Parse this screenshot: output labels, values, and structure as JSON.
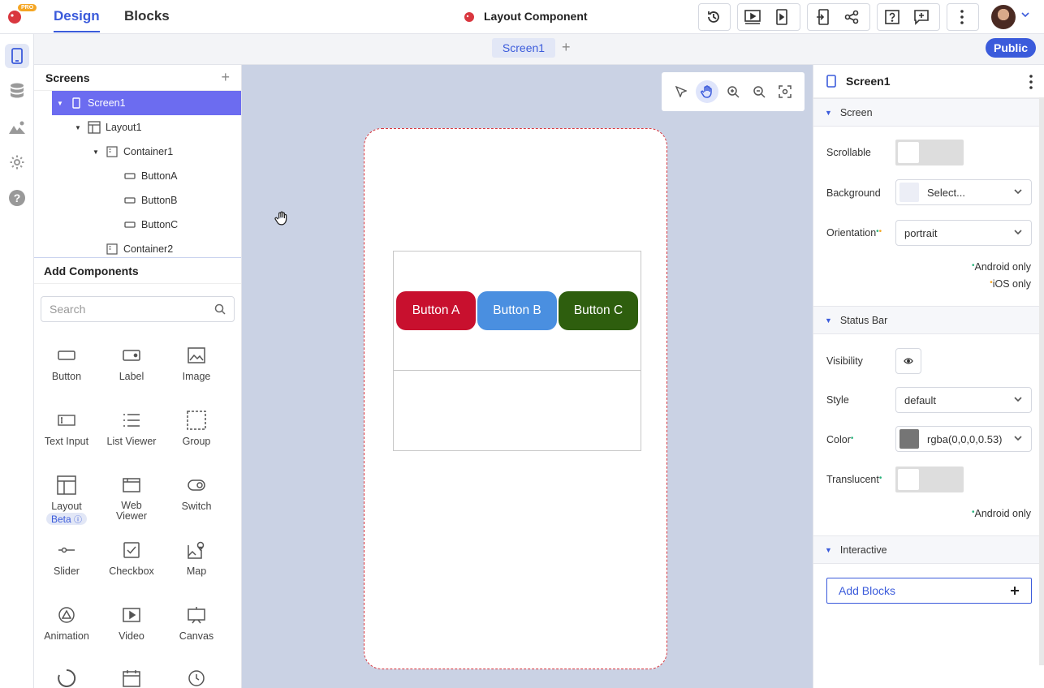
{
  "topbar": {
    "badge": "PRO",
    "tabs": [
      "Design",
      "Blocks"
    ],
    "project_title": "Layout Component"
  },
  "screenbar": {
    "screen_tab": "Screen1",
    "add": "+",
    "public_label": "Public"
  },
  "screens_panel": {
    "title": "Screens",
    "add": "+",
    "tree": [
      {
        "label": "Screen1",
        "icon": "phone-icon"
      },
      {
        "label": "Layout1",
        "icon": "layout-icon"
      },
      {
        "label": "Container1",
        "icon": "container-icon"
      },
      {
        "label": "ButtonA",
        "icon": "button-icon"
      },
      {
        "label": "ButtonB",
        "icon": "button-icon"
      },
      {
        "label": "ButtonC",
        "icon": "button-icon"
      },
      {
        "label": "Container2",
        "icon": "container-icon"
      }
    ]
  },
  "components_panel": {
    "title": "Add Components",
    "search_placeholder": "Search",
    "items": [
      {
        "label": "Button",
        "icon": "button-icon"
      },
      {
        "label": "Label",
        "icon": "label-icon"
      },
      {
        "label": "Image",
        "icon": "image-icon"
      },
      {
        "label": "Text Input",
        "icon": "text-input-icon"
      },
      {
        "label": "List Viewer",
        "icon": "list-icon"
      },
      {
        "label": "Group",
        "icon": "group-icon"
      },
      {
        "label": "Layout",
        "icon": "layout-icon",
        "badge": "Beta"
      },
      {
        "label": "Web Viewer",
        "icon": "web-viewer-icon"
      },
      {
        "label": "Switch",
        "icon": "switch-icon"
      },
      {
        "label": "Slider",
        "icon": "slider-icon"
      },
      {
        "label": "Checkbox",
        "icon": "checkbox-icon"
      },
      {
        "label": "Map",
        "icon": "map-icon"
      },
      {
        "label": "Animation",
        "icon": "animation-icon"
      },
      {
        "label": "Video",
        "icon": "video-icon"
      },
      {
        "label": "Canvas",
        "icon": "canvas-icon"
      }
    ]
  },
  "canvas": {
    "buttons": [
      {
        "label": "Button A",
        "color": "#c8102e"
      },
      {
        "label": "Button B",
        "color": "#4a8fe0"
      },
      {
        "label": "Button C",
        "color": "#2e5e0e"
      }
    ]
  },
  "properties": {
    "title": "Screen1",
    "sections": {
      "screen": "Screen",
      "status_bar": "Status Bar",
      "interactive": "Interactive"
    },
    "scrollable_label": "Scrollable",
    "background_label": "Background",
    "background_value": "Select...",
    "orientation_label": "Orientation",
    "orientation_value": "portrait",
    "android_only": "Android only",
    "ios_only": "iOS only",
    "visibility_label": "Visibility",
    "style_label": "Style",
    "style_value": "default",
    "color_label": "Color",
    "color_value": "rgba(0,0,0,0.53)",
    "translucent_label": "Translucent",
    "add_blocks": "Add Blocks",
    "colors": {
      "accent": "#3b5bdb",
      "android_dot": "#2ab27b",
      "ios_dot": "#f5a623"
    }
  }
}
